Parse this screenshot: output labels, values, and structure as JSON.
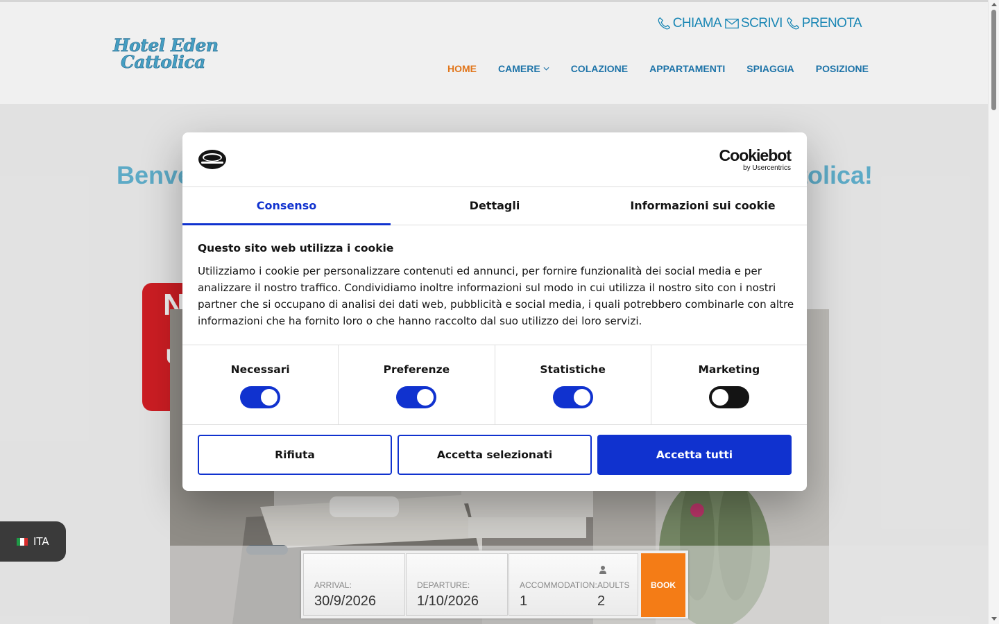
{
  "header": {
    "logo_line1": "Hotel Eden",
    "logo_line2": "Cattolica",
    "contacts": [
      {
        "icon": "phone-icon",
        "label": "CHIAMA"
      },
      {
        "icon": "mail-icon",
        "label": "SCRIVI"
      },
      {
        "icon": "phone-icon",
        "label": "PRENOTA"
      }
    ],
    "nav": [
      {
        "label": "HOME",
        "active": true
      },
      {
        "label": "CAMERE",
        "dropdown": true
      },
      {
        "label": "COLAZIONE"
      },
      {
        "label": "APPARTAMENTI"
      },
      {
        "label": "SPIAGGIA"
      },
      {
        "label": "POSIZIONE"
      }
    ]
  },
  "content": {
    "welcome_left": "Benve",
    "welcome_right": "tolica!",
    "ribbon_line1": "N",
    "ribbon_line2": "U"
  },
  "language": {
    "label": "ITA",
    "flag": "italy-flag-icon"
  },
  "booking": {
    "arrival_label": "ARRIVAL:",
    "arrival_value": "30/9/2026",
    "departure_label": "DEPARTURE:",
    "departure_value": "1/10/2026",
    "accommodation_label": "ACCOMMODATION:",
    "accommodation_value": "1",
    "adults_label": "ADULTS",
    "adults_value": "2",
    "book_label": "BOOK"
  },
  "cookie_dialog": {
    "brand": "Cookiebot",
    "brand_sub": "by Usercentrics",
    "tabs": [
      {
        "label": "Consenso",
        "active": true
      },
      {
        "label": "Dettagli"
      },
      {
        "label": "Informazioni sui cookie"
      }
    ],
    "title": "Questo sito web utilizza i cookie",
    "text": "Utilizziamo i cookie per personalizzare contenuti ed annunci, per fornire funzionalità dei social media e per analizzare il nostro traffico. Condividiamo inoltre informazioni sul modo in cui utilizza il nostro sito con i nostri partner che si occupano di analisi dei dati web, pubblicità e social media, i quali potrebbero combinarle con altre informazioni che ha fornito loro o che hanno raccolto dal suo utilizzo dei loro servizi.",
    "toggles": [
      {
        "label": "Necessari",
        "on": true
      },
      {
        "label": "Preferenze",
        "on": true
      },
      {
        "label": "Statistiche",
        "on": true
      },
      {
        "label": "Marketing",
        "on": false
      }
    ],
    "buttons": {
      "reject": "Rifiuta",
      "accept_selected": "Accetta selezionati",
      "accept_all": "Accetta tutti"
    }
  },
  "colors": {
    "accent_blue": "#1032cf",
    "nav_blue": "#1f7bb3",
    "nav_active": "#f07d1c",
    "book_orange": "#f47c16"
  }
}
